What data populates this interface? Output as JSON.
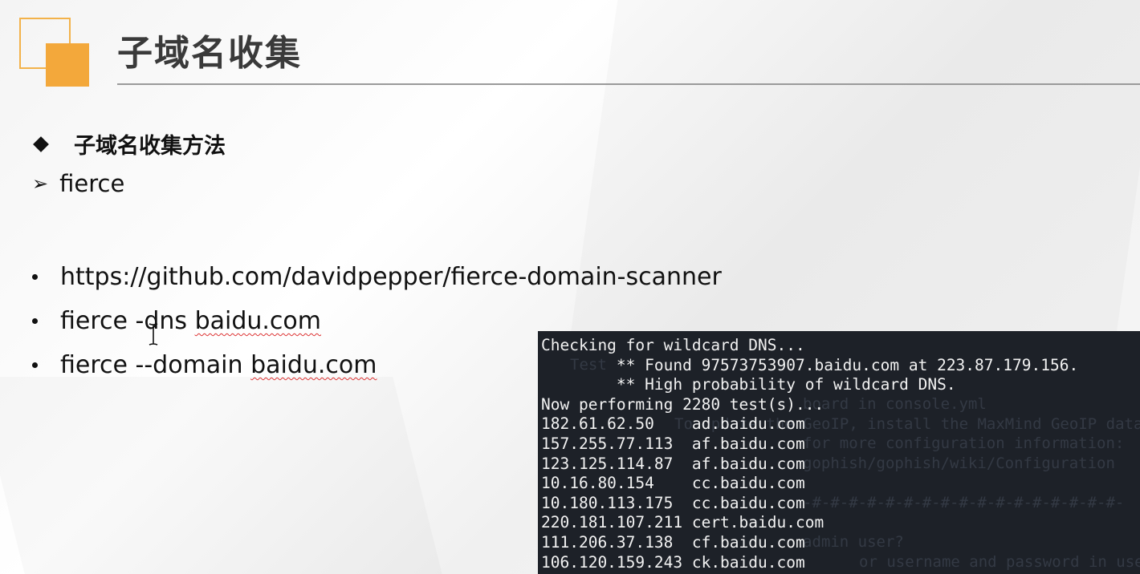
{
  "slide": {
    "title": "子域名收集",
    "section_heading": "子域名收集方法",
    "tool_name": "fierce",
    "bullets": [
      "https://github.com/davidpepper/fierce-domain-scanner",
      "fierce -dns baidu.com",
      "fierce --domain baidu.com"
    ],
    "colors": {
      "accent": "#f3a83b",
      "rule": "#9a9a9a",
      "terminal_bg": "#1d2128"
    }
  },
  "terminal": {
    "lines": [
      "Checking for wildcard DNS...",
      "        ** Found 97573753907.baidu.com at 223.87.179.156.",
      "        ** High probability of wildcard DNS.",
      "Now performing 2280 test(s)...",
      "182.61.62.50    ad.baidu.com",
      "157.255.77.113  af.baidu.com",
      "123.125.114.87  af.baidu.com",
      "10.16.80.154    cc.baidu.com",
      "10.180.113.175  cc.baidu.com",
      "220.181.107.211 cert.baidu.com",
      "111.206.37.138  cf.baidu.com",
      "106.120.159.243 ck.baidu.com"
    ],
    "ghost_lines": [
      "Test",
      "board in console.yml",
      "To update the GeoIP, install the MaxMind GeoIP database",
      "for more configuration information:",
      "gophish/gophish/wiki/Configuration",
      "-#-#-#-#-#-#-#-#-#-#-#-#-#-#-#-#-#-",
      "admin user?",
      "or username and password in use"
    ]
  }
}
